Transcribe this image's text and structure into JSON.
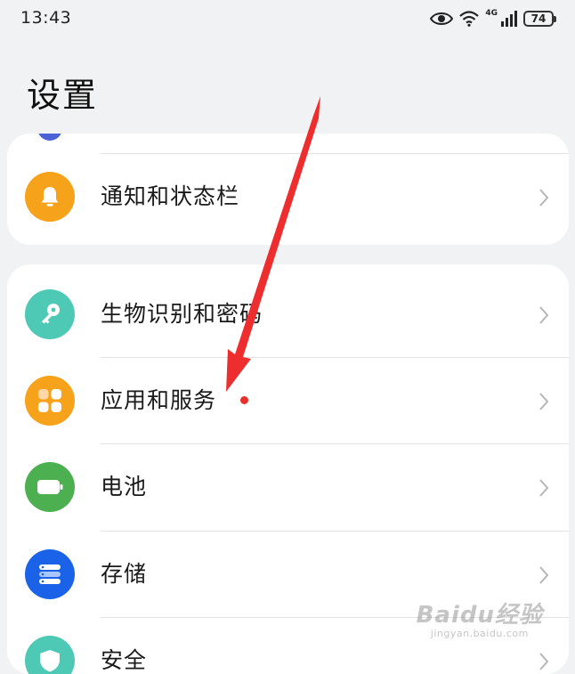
{
  "status_bar": {
    "time": "13:43",
    "network_label": "4G",
    "battery_level": "74",
    "icons": [
      "eye-icon",
      "wifi-icon",
      "cellular-signal-icon",
      "battery-icon"
    ]
  },
  "page": {
    "title": "设置"
  },
  "colors": {
    "background": "#f1f2f4",
    "card": "#ffffff",
    "notification_icon_bg": "#f7a21b",
    "biometrics_icon_bg": "#4dc9b5",
    "apps_icon_bg": "#f7a21b",
    "battery_icon_bg": "#4caf50",
    "storage_icon_bg": "#1a62e8",
    "security_icon_bg": "#4dc9b5",
    "badge_dot": "#e8302a",
    "annotation_arrow": "#ee2e2e"
  },
  "settings": {
    "card1": [
      {
        "label": "通知和状态栏",
        "icon": "bell-icon"
      }
    ],
    "card2": [
      {
        "label": "生物识别和密码",
        "icon": "key-icon"
      },
      {
        "label": "应用和服务",
        "icon": "apps-grid-icon",
        "has_badge_dot": true
      },
      {
        "label": "电池",
        "icon": "battery-icon"
      },
      {
        "label": "存储",
        "icon": "storage-icon"
      },
      {
        "label": "安全",
        "icon": "shield-icon"
      }
    ]
  },
  "annotation": {
    "type": "red-arrow",
    "points_to": "应用和服务"
  },
  "watermark": {
    "logo": "Baidu经验",
    "sub": "jingyan.baidu.com"
  }
}
